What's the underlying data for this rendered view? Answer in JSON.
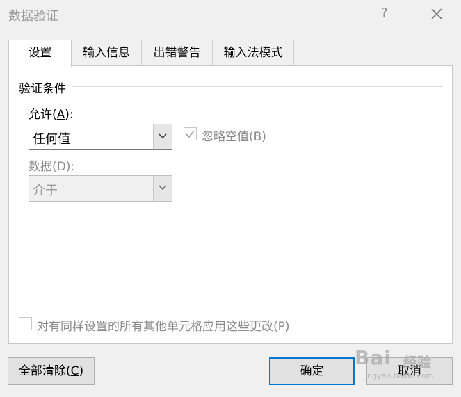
{
  "window": {
    "title": "数据验证",
    "help_icon": "question-icon",
    "close_icon": "close-icon"
  },
  "tabs": [
    {
      "label": "设置",
      "active": true
    },
    {
      "label": "输入信息",
      "active": false
    },
    {
      "label": "出错警告",
      "active": false
    },
    {
      "label": "输入法模式",
      "active": false
    }
  ],
  "settings": {
    "group_title": "验证条件",
    "allow_label": "允许(A):",
    "allow_value": "任何值",
    "ignore_blank_label": "忽略空值(B)",
    "ignore_blank_checked": true,
    "ignore_blank_enabled": false,
    "data_label": "数据(D):",
    "data_value": "介于",
    "data_enabled": false,
    "apply_all_label": "对有同样设置的所有其他单元格应用这些更改(P)",
    "apply_all_checked": false,
    "apply_all_enabled": false
  },
  "buttons": {
    "clear_all": "全部清除(C)",
    "ok": "确定",
    "cancel": "取消"
  },
  "watermark": {
    "main": "Bai",
    "sub": "经验",
    "url": "jingyan.baidu.com"
  },
  "colors": {
    "accent": "#0078d7",
    "background": "#f0f0f0",
    "panel": "#ffffff",
    "disabled_text": "#8a8a8a"
  }
}
